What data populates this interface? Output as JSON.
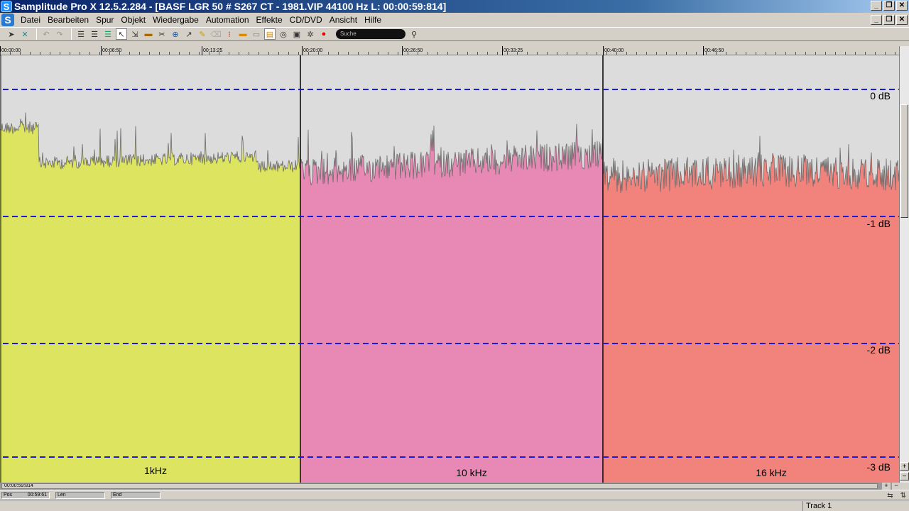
{
  "window": {
    "title": "Samplitude Pro X 12.5.2.284 - [BASF LGR 50 # S267 CT - 1981.VIP   44100 Hz L: 00:00:59:814]",
    "app_logo": "S",
    "buttons": [
      "minimize-icon",
      "restore-icon",
      "close-icon"
    ]
  },
  "menu": {
    "logo": "S",
    "items": [
      "Datei",
      "Bearbeiten",
      "Spur",
      "Objekt",
      "Wiedergabe",
      "Automation",
      "Effekte",
      "CD/DVD",
      "Ansicht",
      "Hilfe"
    ]
  },
  "toolbar": {
    "search_placeholder": "Suche",
    "icons": [
      "pointer-icon",
      "crossfade-icon",
      "undo-icon",
      "redo-icon",
      "list-icon",
      "list-icon",
      "list-selected-icon",
      "select-tool-icon",
      "range-tool-icon",
      "object-tool-icon",
      "cut-tool-icon",
      "zoom-tool-icon",
      "scrub-tool-icon",
      "pencil-tool-icon",
      "eraser-tool-icon",
      "marker-tool-icon",
      "color-tool-icon",
      "envelope-tool-icon",
      "object-edit-icon",
      "loop-icon",
      "monitor-icon",
      "settings-icon",
      "record-icon"
    ],
    "search_icon": "magnifier-icon"
  },
  "ruler": {
    "labels": [
      "00:00:00",
      "00:06:50",
      "00:13:25",
      "00:20:00",
      "00:26:50",
      "00:33:25",
      "00:40:00",
      "00:46:50"
    ]
  },
  "waveform": {
    "segments": [
      {
        "label": "1kHz",
        "color": "#dde460"
      },
      {
        "label": "10 kHz",
        "color": "#e888b4"
      },
      {
        "label": "16 kHz",
        "color": "#f2837c"
      }
    ],
    "db_lines": [
      "0 dB",
      "-1 dB",
      "-2 dB",
      "-3 dB"
    ],
    "background": "#dcdcdc",
    "grid_color": "#1a1ad8"
  },
  "hscroll": {
    "position_text": "00:00:59:814"
  },
  "status": {
    "pos_label": "Pos",
    "pos_value": "00:59:61",
    "len_label": "Len",
    "end_label": "End",
    "track": "Track 1"
  }
}
